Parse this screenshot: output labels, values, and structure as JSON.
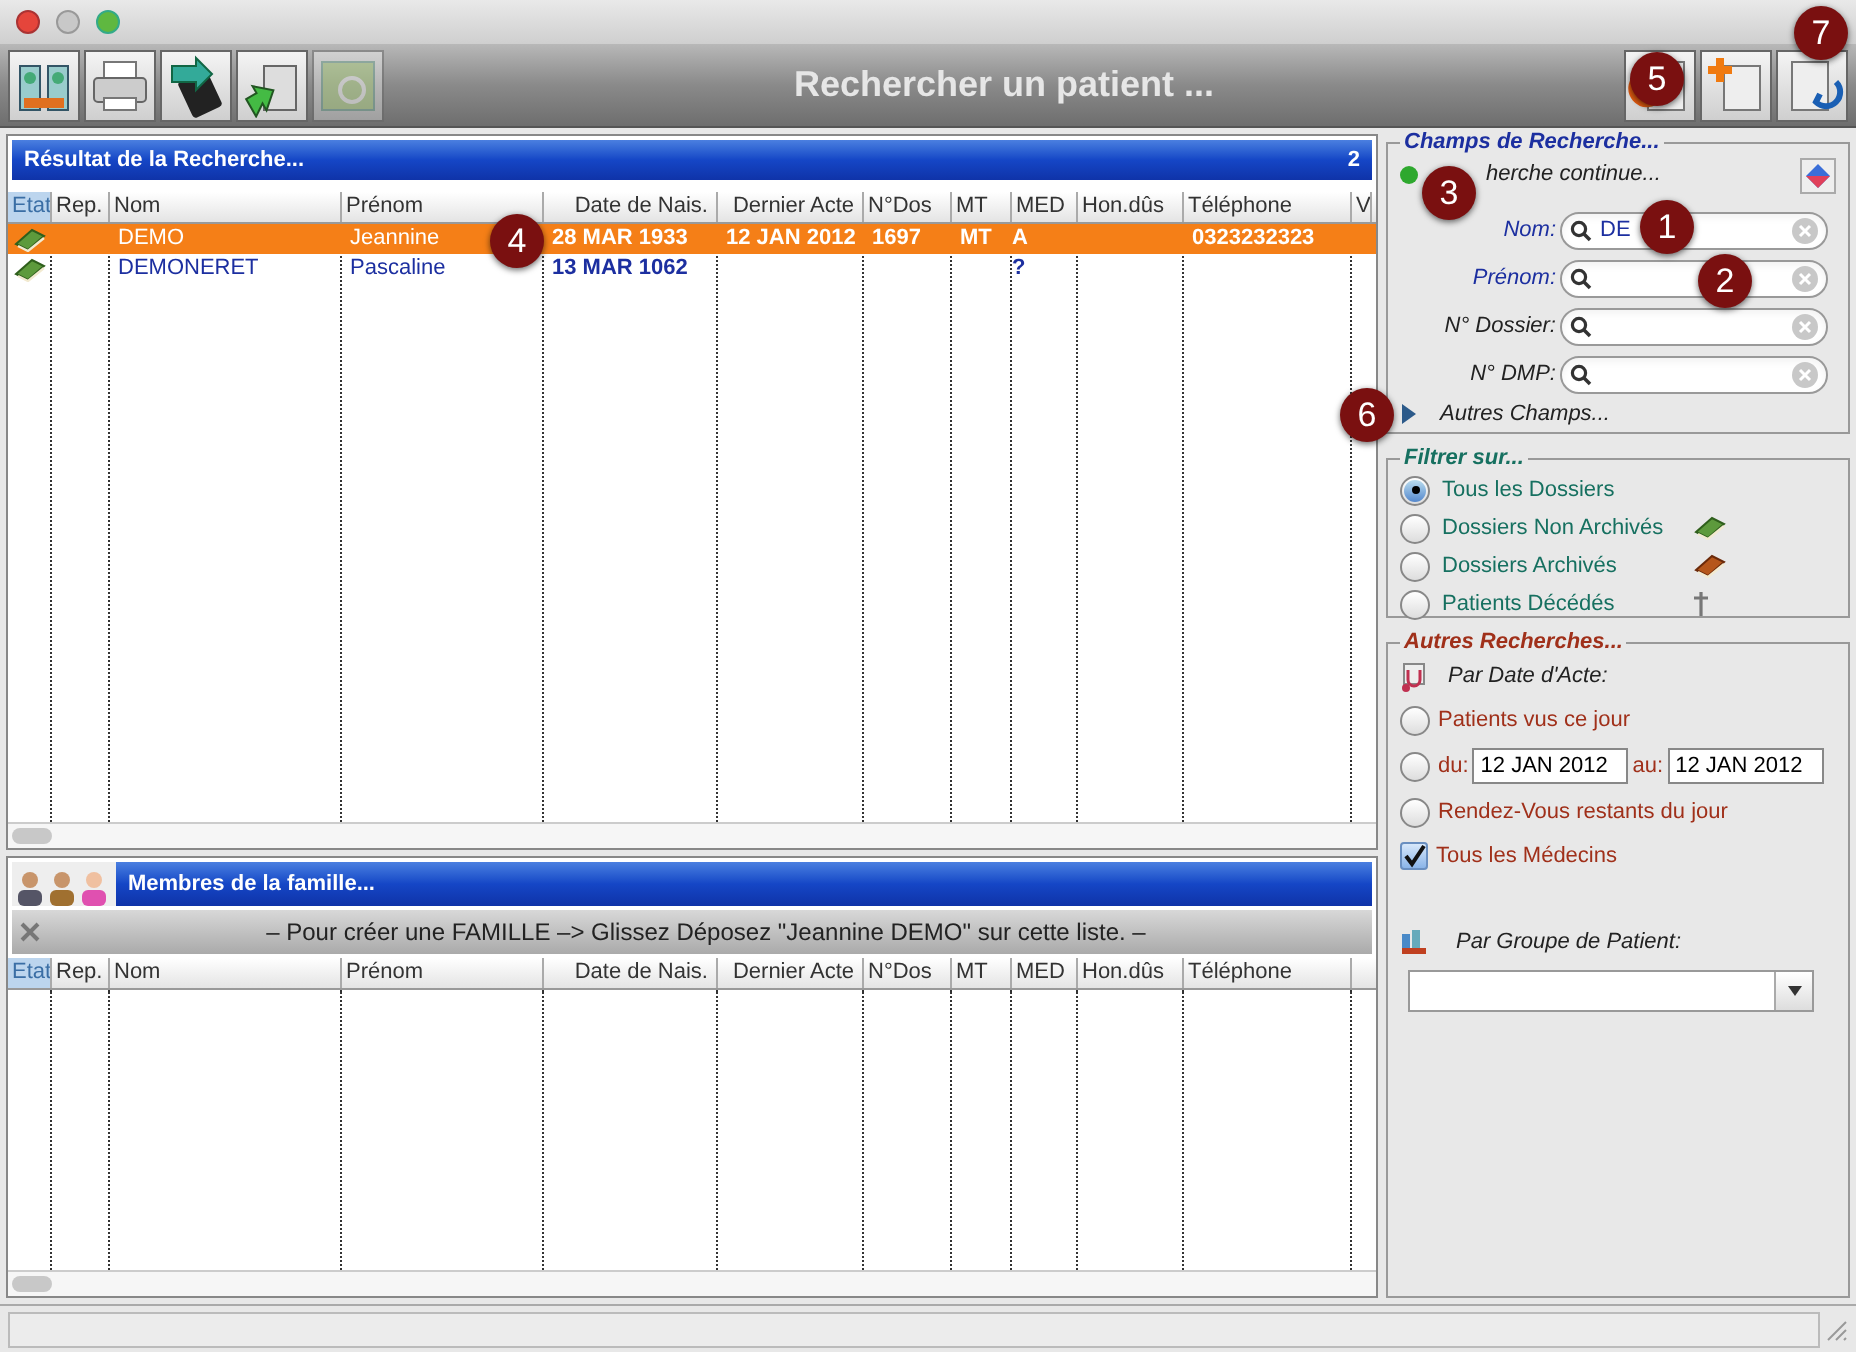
{
  "toolbar": {
    "title": "Rechercher un patient ...",
    "left_buttons": [
      {
        "kind": "contacts",
        "disabled": false
      },
      {
        "kind": "printer",
        "disabled": false
      },
      {
        "kind": "phone",
        "disabled": false
      },
      {
        "kind": "export",
        "disabled": false
      },
      {
        "kind": "card",
        "disabled": true
      }
    ],
    "right_buttons": [
      {
        "kind": "undo"
      },
      {
        "kind": "new"
      },
      {
        "kind": "back"
      }
    ]
  },
  "results": {
    "title": "Résultat de la Recherche...",
    "count": "2",
    "columns": [
      {
        "label": "Etat",
        "selected": true
      },
      {
        "label": "Rep.",
        "selected": false
      },
      {
        "label": "Nom",
        "selected": false
      },
      {
        "label": "Prénom",
        "selected": false
      },
      {
        "label": "Date de Nais.",
        "selected": false
      },
      {
        "label": "Dernier Acte",
        "selected": false
      },
      {
        "label": "N°Dos",
        "selected": false
      },
      {
        "label": "MT",
        "selected": false
      },
      {
        "label": "MED",
        "selected": false
      },
      {
        "label": "Hon.dûs",
        "selected": false
      },
      {
        "label": "Téléphone",
        "selected": false
      },
      {
        "label": "V",
        "selected": false
      }
    ],
    "rows": [
      {
        "selected": true,
        "kind": "non_archive",
        "nom": "DEMO",
        "prenom": "Jeannine",
        "date_naissance": "28 MAR 1933",
        "dernier_acte": "12 JAN 2012",
        "n_dos": "1697",
        "mt": "MT",
        "med": "A",
        "telephone": "0323232323"
      },
      {
        "selected": false,
        "kind": "non_archive",
        "nom": "DEMONERET",
        "prenom": "Pascaline",
        "date_naissance": "13 MAR 1062",
        "med": "?"
      }
    ]
  },
  "family": {
    "title": "Membres de la famille...",
    "message": "– Pour créer une FAMILLE –> Glissez Déposez \"Jeannine DEMO\" sur cette liste. –",
    "columns": [
      {
        "label": "Etat",
        "selected": true
      },
      {
        "label": "Rep.",
        "selected": false
      },
      {
        "label": "Nom",
        "selected": false
      },
      {
        "label": "Prénom",
        "selected": false
      },
      {
        "label": "Date de Nais.",
        "selected": false
      },
      {
        "label": "Dernier Acte",
        "selected": false
      },
      {
        "label": "N°Dos",
        "selected": false
      },
      {
        "label": "MT",
        "selected": false
      },
      {
        "label": "MED",
        "selected": false
      },
      {
        "label": "Hon.dûs",
        "selected": false
      },
      {
        "label": "Téléphone",
        "selected": false
      }
    ]
  },
  "search": {
    "title": "Champs de Recherche...",
    "continuous": {
      "label": "herche continue...",
      "on": true
    },
    "fields": [
      {
        "label": "Nom:",
        "value": "DE",
        "highlighted": true
      },
      {
        "label": "Prénom:",
        "highlighted": true
      },
      {
        "label": "N° Dossier:",
        "highlighted": false
      },
      {
        "label": "N° DMP:",
        "highlighted": false
      }
    ],
    "more": {
      "label": "Autres Champs...",
      "expanded": false
    }
  },
  "filter": {
    "title": "Filtrer sur...",
    "options": [
      {
        "label": "Tous les Dossiers",
        "selected": true,
        "kind": "plain"
      },
      {
        "label": "Dossiers Non Archivés",
        "selected": false,
        "kind": "green_book"
      },
      {
        "label": "Dossiers Archivés",
        "selected": false,
        "kind": "brown_book"
      },
      {
        "label": "Patients Décédés",
        "selected": false,
        "kind": "cross"
      }
    ]
  },
  "other": {
    "title": "Autres Recherches...",
    "by_date": "Par Date d'Acte:",
    "options": [
      {
        "kind": "radio",
        "label": "Patients vus ce jour",
        "selected": false
      },
      {
        "kind": "range",
        "from_label": "du:",
        "from": "12 JAN 2012",
        "to_label": "au:",
        "to": "12 JAN 2012",
        "selected": false
      },
      {
        "kind": "radio",
        "label": "Rendez-Vous restants du jour",
        "selected": false
      }
    ],
    "all_doctors": {
      "label": "Tous les Médecins",
      "checked": true
    },
    "group_label": "Par Groupe de Patient:"
  },
  "callouts": [
    {
      "label": "1"
    },
    {
      "label": "2"
    },
    {
      "label": "3"
    },
    {
      "label": "4"
    },
    {
      "label": "5"
    },
    {
      "label": "6"
    },
    {
      "label": "7"
    }
  ]
}
